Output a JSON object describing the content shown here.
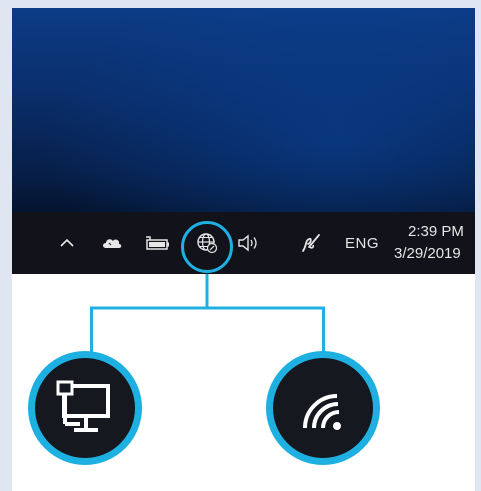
{
  "taskbar": {
    "language": "ENG",
    "clock": {
      "time": "2:39 PM",
      "date": "3/29/2019"
    },
    "tray_icons": [
      "chevron-up-icon",
      "onedrive-cloud-icon",
      "battery-power-icon",
      "network-globe-icon",
      "volume-icon",
      "pen-ink-icon"
    ]
  },
  "callouts": [
    {
      "icon": "wired-network-icon"
    },
    {
      "icon": "wifi-icon"
    }
  ],
  "colors": {
    "accent": "#1fb0e2",
    "taskbar": "#12131a",
    "desktop": "#0a2f6c",
    "badge_fill": "#15181e"
  }
}
